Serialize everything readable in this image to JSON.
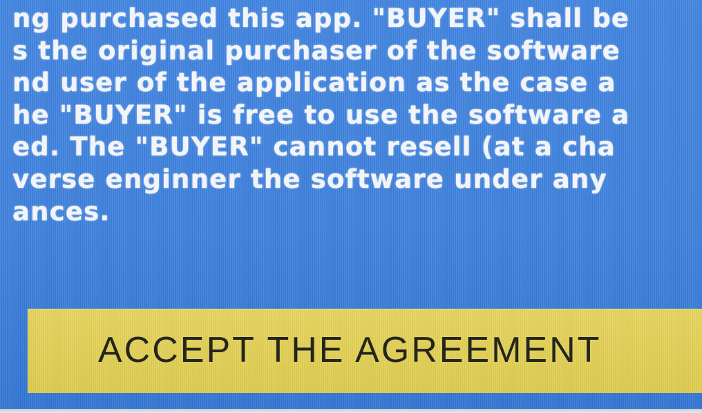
{
  "agreement": {
    "lines": [
      "ng purchased this app. \"BUYER\" shall be",
      "s the original purchaser of the software",
      "nd user of the application as the case a",
      "he \"BUYER\" is free to use the software a",
      "ed. The \"BUYER\" cannot resell (at a cha",
      "verse enginner the software under any",
      "ances."
    ]
  },
  "actions": {
    "accept_label": "ACCEPT THE AGREEMENT"
  },
  "colors": {
    "background": "#3b7fdc",
    "text": "#f2f4f8",
    "button": "#dccb4c",
    "button_text": "#25251c"
  }
}
